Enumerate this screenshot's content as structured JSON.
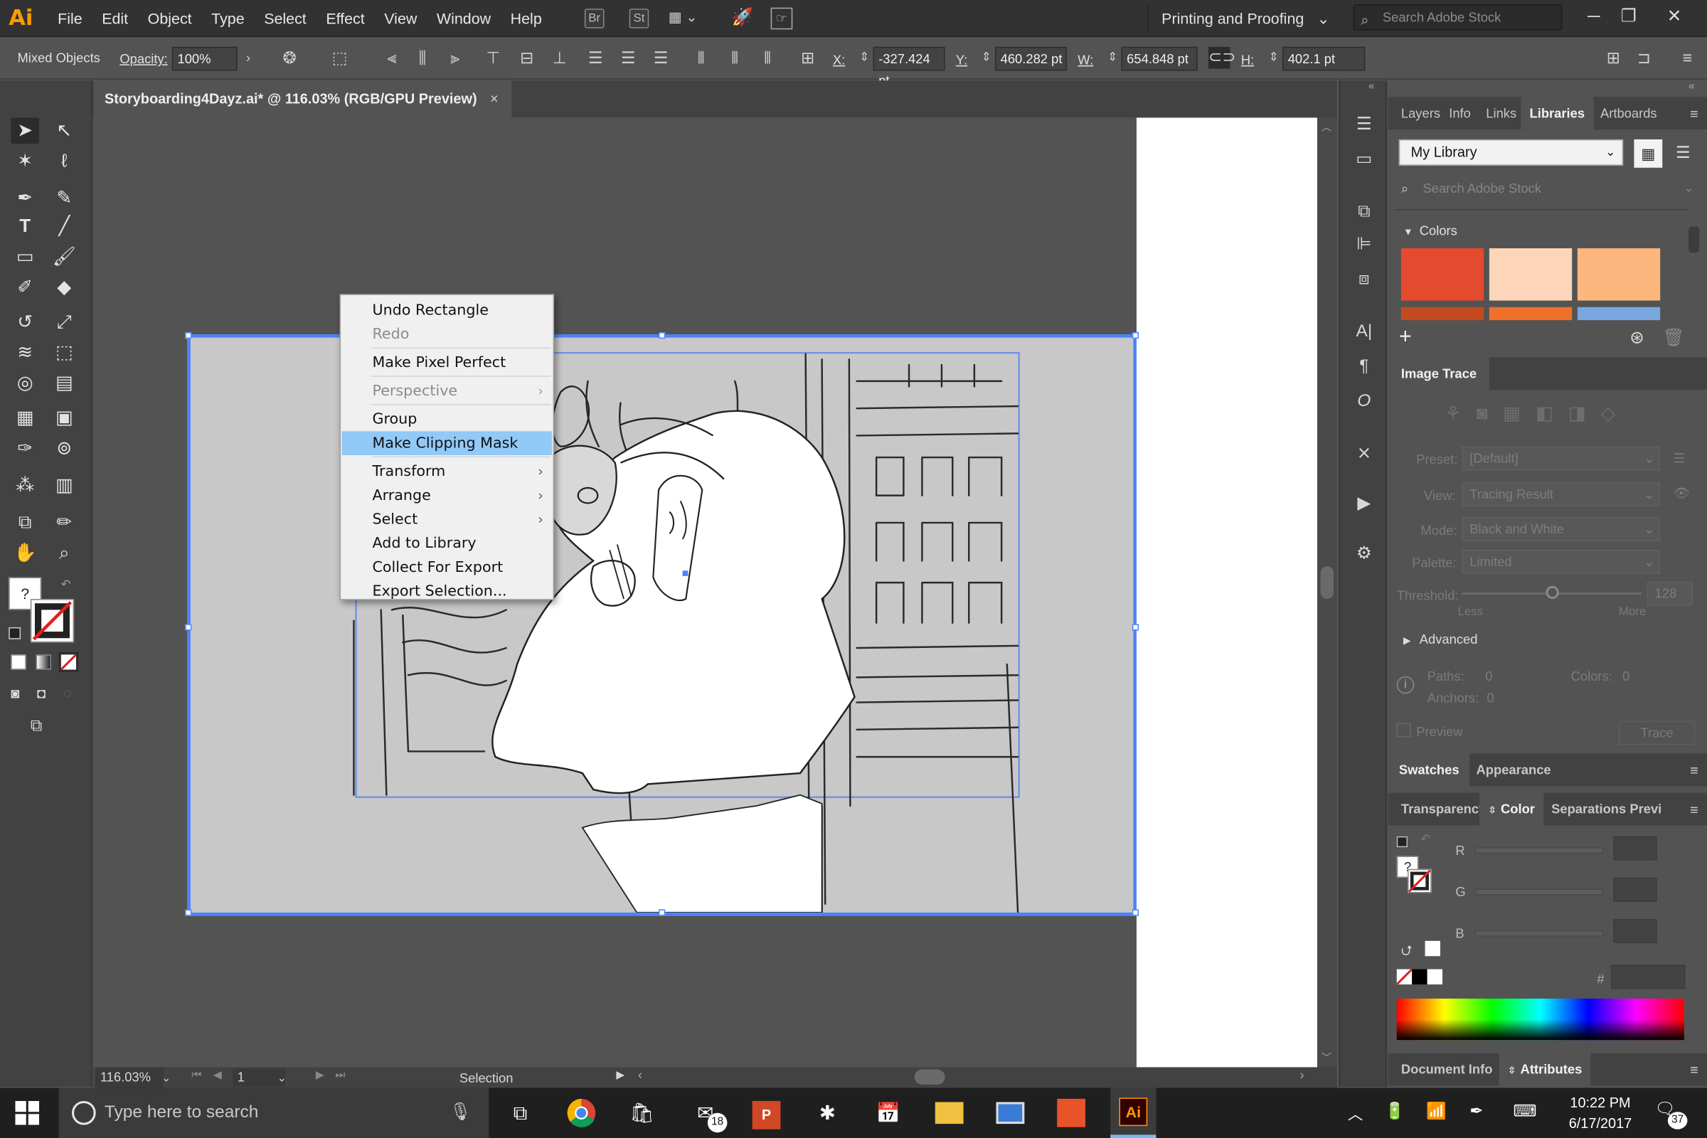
{
  "app": {
    "logo": "Ai"
  },
  "menubar": {
    "items": [
      "File",
      "Edit",
      "Object",
      "Type",
      "Select",
      "Effect",
      "View",
      "Window",
      "Help"
    ],
    "bridge_label": "Br",
    "stock_label": "St",
    "workspace": "Printing and Proofing",
    "search_placeholder": "Search Adobe Stock"
  },
  "controlbar": {
    "selection_type": "Mixed Objects",
    "opacity_label": "Opacity:",
    "opacity_value": "100%",
    "x_label": "X:",
    "x_value": "-327.424 pt",
    "y_label": "Y:",
    "y_value": "460.282 pt",
    "w_label": "W:",
    "w_value": "654.848 pt",
    "h_label": "H:",
    "h_value": "402.1 pt"
  },
  "document_tab": {
    "title": "Storyboarding4Dayz.ai* @ 116.03% (RGB/GPU Preview)",
    "close": "×"
  },
  "context_menu": {
    "items": [
      {
        "label": "Undo Rectangle"
      },
      {
        "label": "Redo"
      },
      {
        "label": "Make Pixel Perfect"
      },
      {
        "label": "Perspective"
      },
      {
        "label": "Group"
      },
      {
        "label": "Make Clipping Mask"
      },
      {
        "label": "Transform"
      },
      {
        "label": "Arrange"
      },
      {
        "label": "Select"
      },
      {
        "label": "Add to Library"
      },
      {
        "label": "Collect For Export"
      },
      {
        "label": "Export Selection..."
      }
    ]
  },
  "statusbar": {
    "zoom": "116.03%",
    "artboard": "1",
    "tool": "Selection"
  },
  "panels": {
    "top_tabs": [
      "Layers",
      "Info",
      "Links",
      "Libraries",
      "Artboards"
    ],
    "library_name": "My Library",
    "library_search": "Search Adobe Stock",
    "colors_header": "Colors",
    "swatch_colors": [
      "#e44a2e",
      "#fdd6b9",
      "#fdb67e"
    ],
    "swatch_colors_row2": [
      "#c44a20",
      "#f0702a",
      "#7aa7e0"
    ],
    "image_trace": {
      "title": "Image Trace",
      "preset_label": "Preset:",
      "preset_value": "[Default]",
      "view_label": "View:",
      "view_value": "Tracing Result",
      "mode_label": "Mode:",
      "mode_value": "Black and White",
      "palette_label": "Palette:",
      "palette_value": "Limited",
      "threshold_label": "Threshold:",
      "threshold_value": "128",
      "less": "Less",
      "more": "More",
      "advanced": "Advanced",
      "paths_label": "Paths:",
      "paths_value": "0",
      "colors_label": "Colors:",
      "colors_value": "0",
      "anchors_label": "Anchors:",
      "anchors_value": "0",
      "preview": "Preview",
      "trace": "Trace"
    },
    "swatches_tabs": [
      "Swatches",
      "Appearance"
    ],
    "color_tabs": [
      "Transparency",
      "Color",
      "Separations Previ"
    ],
    "rgb": [
      "R",
      "G",
      "B"
    ],
    "hash": "#",
    "bottom_tabs": [
      "Document Info",
      "Attributes"
    ]
  },
  "taskbar": {
    "search_placeholder": "Type here to search",
    "mail_badge": "18",
    "ai_label": "Ai",
    "time": "10:22 PM",
    "date": "6/17/2017",
    "notif_count": "37"
  }
}
